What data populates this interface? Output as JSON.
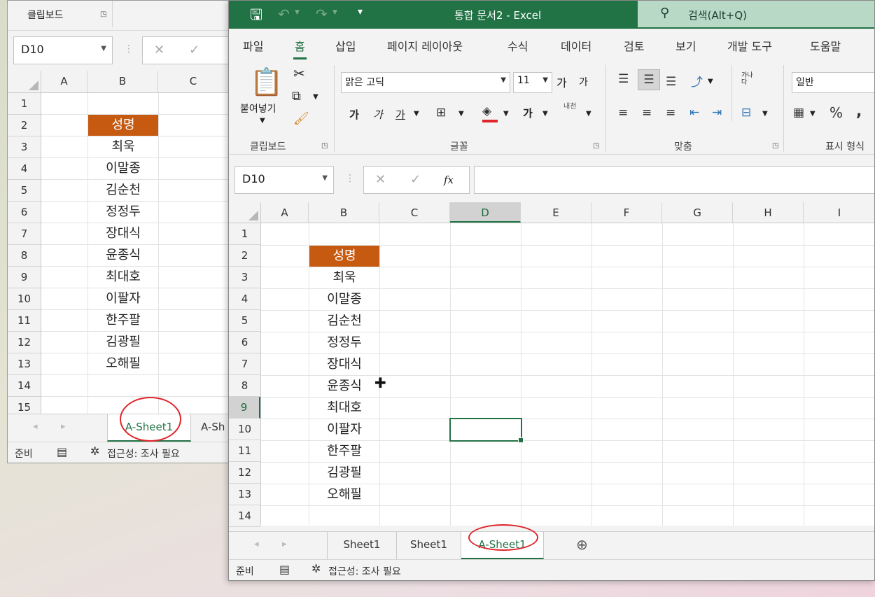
{
  "back_window": {
    "clipboard_label": "클립보드",
    "name_box": "D10",
    "columns": [
      "A",
      "B",
      "C"
    ],
    "rows": [
      "1",
      "2",
      "3",
      "4",
      "5",
      "6",
      "7",
      "8",
      "9",
      "10",
      "11",
      "12",
      "13",
      "14",
      "15"
    ],
    "cells": [
      "성명",
      "최욱",
      "이말종",
      "김순천",
      "정정두",
      "장대식",
      "윤종식",
      "최대호",
      "이팔자",
      "한주팔",
      "김광필",
      "오해필"
    ],
    "tabs": [
      "A-Sheet1",
      "A-Sh"
    ],
    "status_ready": "준비",
    "status_accessibility": "접근성: 조사 필요"
  },
  "front_window": {
    "title": "통합 문서2  -  Excel",
    "search_label": "검색(Alt+Q)",
    "menus": [
      "파일",
      "홈",
      "삽입",
      "페이지 레이아웃",
      "수식",
      "데이터",
      "검토",
      "보기",
      "개발 도구",
      "도움말"
    ],
    "ribbon": {
      "paste_label": "붙여넣기",
      "clipboard_group": "클립보드",
      "font_name": "맑은 고딕",
      "font_size": "11",
      "font_group": "글꼴",
      "alignment_group": "맞춤",
      "number_format": "일반",
      "number_group": "표시 형식",
      "bold": "가",
      "italic": "가",
      "underline": "가",
      "grow_font": "가",
      "shrink_font": "가",
      "phonetic": "내천",
      "wrap_label": "가나다"
    },
    "name_box": "D10",
    "fx_label": "fx",
    "columns": [
      "A",
      "B",
      "C",
      "D",
      "E",
      "F",
      "G",
      "H",
      "I"
    ],
    "rows": [
      "1",
      "2",
      "3",
      "4",
      "5",
      "6",
      "7",
      "8",
      "9",
      "10",
      "11",
      "12",
      "13",
      "14"
    ],
    "cells": [
      "성명",
      "최욱",
      "이말종",
      "김순천",
      "정정두",
      "장대식",
      "윤종식",
      "최대호",
      "이팔자",
      "한주팔",
      "김광필",
      "오해필"
    ],
    "tabs": [
      "Sheet1",
      "Sheet1",
      "A-Sheet1"
    ],
    "status_ready": "준비",
    "status_accessibility": "접근성: 조사 필요"
  },
  "colors": {
    "excel_green": "#217346",
    "header_fill": "#c65a11",
    "highlight_circle": "#e0242a"
  }
}
